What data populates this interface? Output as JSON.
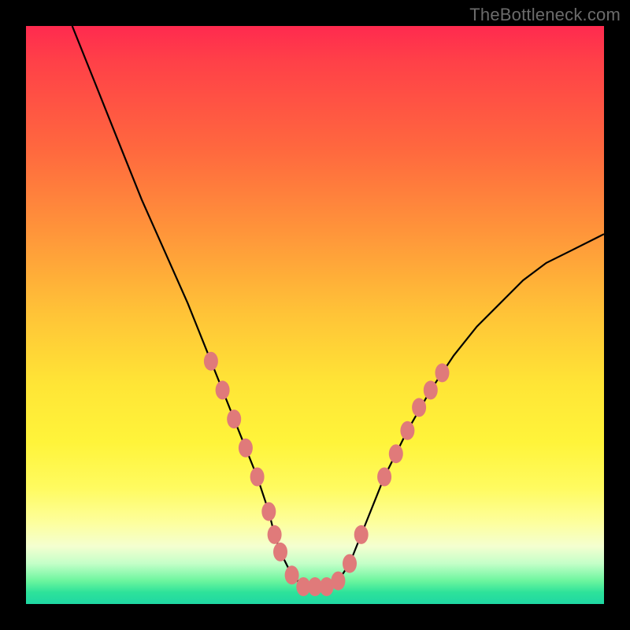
{
  "watermark": "TheBottleneck.com",
  "chart_data": {
    "type": "line",
    "title": "",
    "xlabel": "",
    "ylabel": "",
    "xlim": [
      0,
      100
    ],
    "ylim": [
      0,
      100
    ],
    "curve": {
      "name": "bottleneck-curve",
      "x": [
        8,
        12,
        16,
        20,
        24,
        28,
        30,
        32,
        34,
        36,
        38,
        40,
        42,
        43,
        44,
        46,
        48,
        50,
        52,
        54,
        56,
        58,
        62,
        66,
        70,
        74,
        78,
        82,
        86,
        90,
        94,
        98,
        100
      ],
      "y": [
        100,
        90,
        80,
        70,
        61,
        52,
        47,
        42,
        37,
        32,
        27,
        22,
        16,
        12,
        9,
        5,
        3,
        3,
        3,
        4,
        7,
        12,
        22,
        30,
        37,
        43,
        48,
        52,
        56,
        59,
        61,
        63,
        64
      ]
    },
    "markers": {
      "name": "highlight-points",
      "color": "#e07a7a",
      "points": [
        {
          "x": 32,
          "y": 42
        },
        {
          "x": 34,
          "y": 37
        },
        {
          "x": 36,
          "y": 32
        },
        {
          "x": 38,
          "y": 27
        },
        {
          "x": 40,
          "y": 22
        },
        {
          "x": 42,
          "y": 16
        },
        {
          "x": 43,
          "y": 12
        },
        {
          "x": 44,
          "y": 9
        },
        {
          "x": 46,
          "y": 5
        },
        {
          "x": 48,
          "y": 3
        },
        {
          "x": 50,
          "y": 3
        },
        {
          "x": 52,
          "y": 3
        },
        {
          "x": 54,
          "y": 4
        },
        {
          "x": 56,
          "y": 7
        },
        {
          "x": 58,
          "y": 12
        },
        {
          "x": 62,
          "y": 22
        },
        {
          "x": 64,
          "y": 26
        },
        {
          "x": 66,
          "y": 30
        },
        {
          "x": 68,
          "y": 34
        },
        {
          "x": 70,
          "y": 37
        },
        {
          "x": 72,
          "y": 40
        }
      ]
    }
  }
}
